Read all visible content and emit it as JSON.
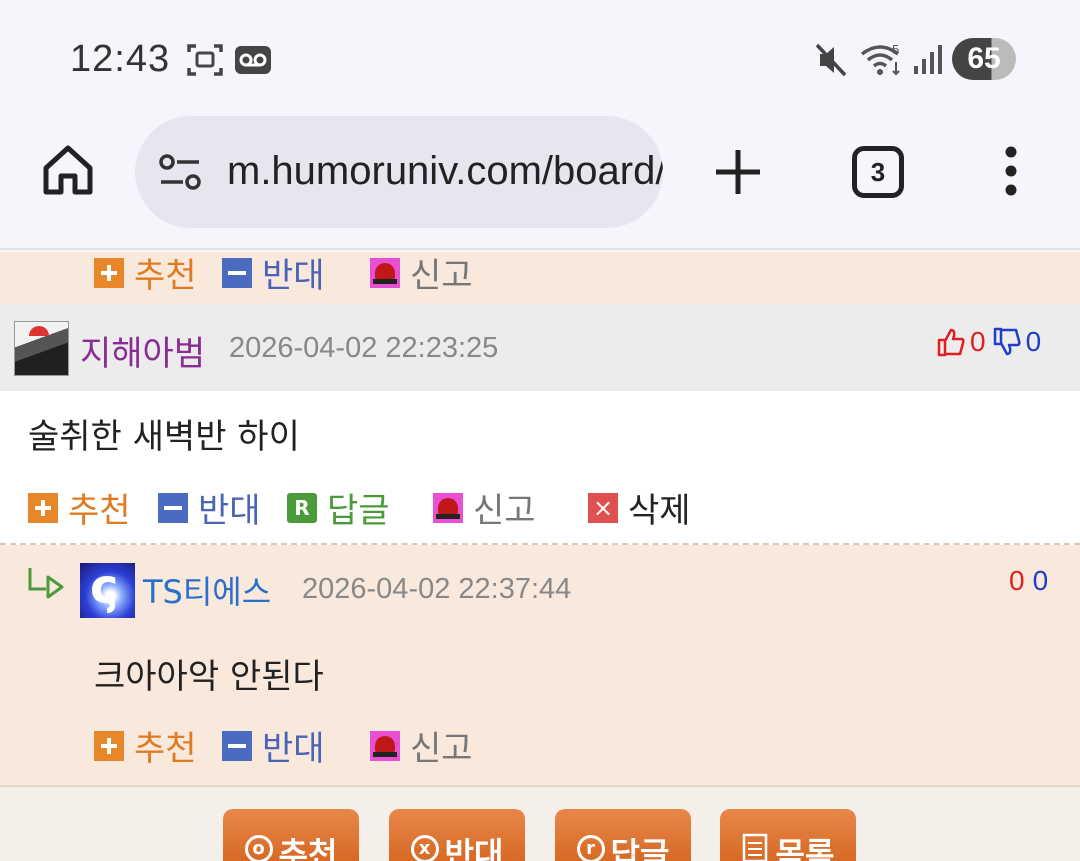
{
  "status_bar": {
    "time": "12:43",
    "battery": "65",
    "icons": [
      "screenshot-icon",
      "voicemail-icon",
      "mute-icon",
      "wifi-icon",
      "signal-icon",
      "battery-icon"
    ]
  },
  "browser": {
    "url": "m.humoruniv.com/board/",
    "tab_count": "3"
  },
  "prev_actions": {
    "recommend": "추천",
    "oppose": "반대",
    "report": "신고"
  },
  "comment1": {
    "author": "지해아범",
    "date": "2026-04-02 22:23:25",
    "up": "0",
    "down": "0",
    "text": "술취한 새벽반 하이",
    "actions": {
      "recommend": "추천",
      "oppose": "반대",
      "reply": "답글",
      "report": "신고",
      "delete": "삭제"
    }
  },
  "comment2": {
    "author": "TS티에스",
    "date": "2026-04-02 22:37:44",
    "up": "0",
    "down": "0",
    "text": "크아아악 안된다",
    "actions": {
      "recommend": "추천",
      "oppose": "반대",
      "report": "신고"
    }
  },
  "bottom_buttons": {
    "recommend": "추천",
    "oppose": "반대",
    "reply": "답글",
    "list": "목록",
    "recommend_key": "o",
    "oppose_key": "x",
    "reply_key": "r"
  },
  "colors": {
    "tan_background": "#f8e9dc",
    "orange_action": "#e07b22",
    "blue_action": "#4b64b8",
    "author1": "#8a2c94",
    "author2": "#2b6fcc",
    "button_orange": "#d9692a"
  }
}
